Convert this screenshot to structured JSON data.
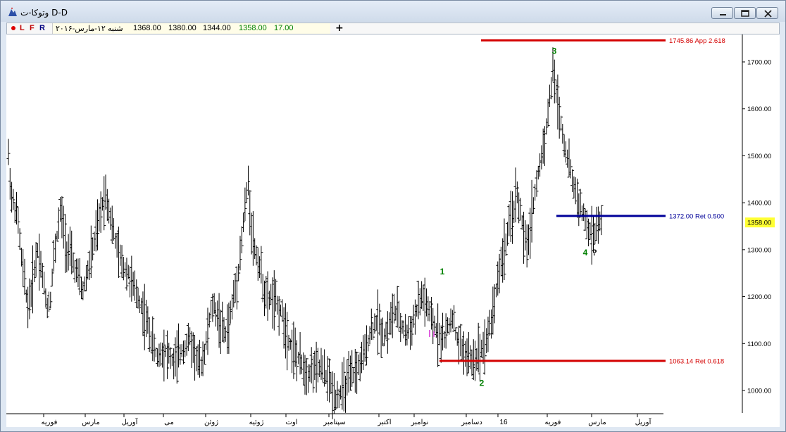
{
  "window": {
    "title": "وتوکا-ت D-D",
    "buttons": {
      "minimize": "minimize",
      "maximize": "maximize",
      "close": "close"
    }
  },
  "toolbar": {
    "labels": [
      "L",
      "F",
      "R"
    ],
    "date": "شنبه ۱۲-مارس-۲۰۱۶",
    "open": "1368.00",
    "high": "1380.00",
    "low": "1344.00",
    "close": "1358.00",
    "change": "17.00",
    "add": "+"
  },
  "colors": {
    "red_line": "#d40000",
    "blue_line": "#000099",
    "wave_label": "#008000",
    "price_tag": "#ffff33"
  },
  "chart_data": {
    "type": "ohlc",
    "ylim": [
      960,
      1760
    ],
    "yticks": [
      "1000.00",
      "1100.00",
      "1200.00",
      "1300.00",
      "1400.00",
      "1500.00",
      "1600.00",
      "1700.00"
    ],
    "xlabels": [
      "فوریه",
      "مارس",
      "آوریل",
      "می",
      "ژوئن",
      "ژوئیه",
      "اوت",
      "سپتامبر",
      "اکتبر",
      "نوامبر",
      "دسامبر",
      "16",
      "فوریه",
      "مارس",
      "آوریل"
    ],
    "last_price": "1358.00",
    "levels": [
      {
        "label": "1745.86 App 2.618",
        "value": 1745.86,
        "color": "red"
      },
      {
        "label": "1372.00 Ret 0.500",
        "value": 1372.0,
        "color": "blue"
      },
      {
        "label": "1063.14 Ret 0.618",
        "value": 1063.14,
        "color": "red"
      }
    ],
    "wave_labels": [
      {
        "text": "1",
        "value": 1235
      },
      {
        "text": "2",
        "value": 1040
      },
      {
        "text": "3",
        "value": 1705
      },
      {
        "text": "4",
        "value": 1318
      },
      {
        "text": "?",
        "value": 1318
      }
    ],
    "price_path": [
      1500,
      1410,
      1390,
      1360,
      1280,
      1230,
      1180,
      1210,
      1260,
      1300,
      1270,
      1220,
      1180,
      1200,
      1280,
      1330,
      1380,
      1350,
      1300,
      1290,
      1270,
      1250,
      1230,
      1210,
      1240,
      1270,
      1300,
      1330,
      1360,
      1400,
      1420,
      1390,
      1350,
      1320,
      1290,
      1270,
      1260,
      1250,
      1230,
      1210,
      1200,
      1180,
      1160,
      1140,
      1110,
      1090,
      1070,
      1080,
      1090,
      1080,
      1070,
      1060,
      1070,
      1080,
      1090,
      1100,
      1110,
      1090,
      1070,
      1050,
      1070,
      1100,
      1150,
      1180,
      1170,
      1150,
      1130,
      1120,
      1140,
      1180,
      1220,
      1260,
      1320,
      1390,
      1440,
      1350,
      1300,
      1280,
      1250,
      1210,
      1190,
      1200,
      1190,
      1180,
      1170,
      1150,
      1120,
      1100,
      1090,
      1070,
      1060,
      1050,
      1040,
      1040,
      1050,
      1040,
      1050,
      1040,
      1030,
      1020,
      1000,
      990,
      990,
      1000,
      1010,
      1020,
      1030,
      1040,
      1050,
      1060,
      1080,
      1110,
      1130,
      1140,
      1150,
      1130,
      1120,
      1130,
      1150,
      1170,
      1160,
      1140,
      1130,
      1120,
      1130,
      1150,
      1170,
      1190,
      1200,
      1180,
      1160,
      1140,
      1130,
      1120,
      1110,
      1120,
      1140,
      1160,
      1120,
      1100,
      1090,
      1080,
      1070,
      1060,
      1070,
      1080,
      1090,
      1100,
      1120,
      1150,
      1190,
      1240,
      1270,
      1300,
      1330,
      1360,
      1390,
      1420,
      1380,
      1330,
      1300,
      1350,
      1400,
      1440,
      1480,
      1520,
      1560,
      1620,
      1680,
      1640,
      1590,
      1550,
      1510,
      1480,
      1450,
      1420,
      1400,
      1380,
      1360,
      1340,
      1330,
      1340,
      1350,
      1358
    ],
    "marker_zone_value": 1120
  }
}
